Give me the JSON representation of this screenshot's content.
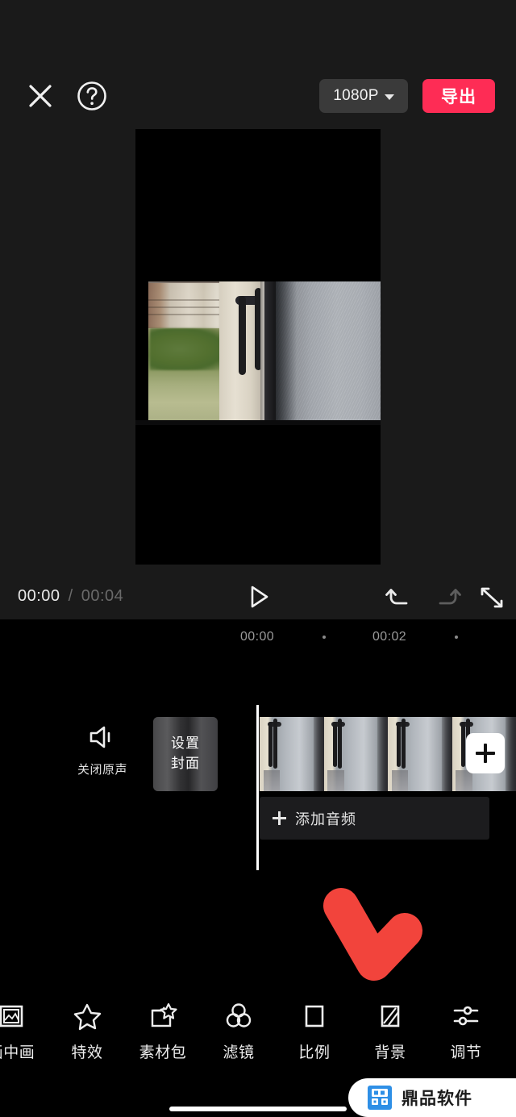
{
  "header": {
    "close_icon": "close-icon",
    "help_icon": "help-circle-icon",
    "resolution": "1080P",
    "resolution_caret": "chevron-down-icon",
    "export_label": "导出"
  },
  "preview": {
    "scene_description": "门口与灰色墙面"
  },
  "player": {
    "current_time": "00:00",
    "separator": "/",
    "total_time": "00:04",
    "play_icon": "play-icon",
    "undo_icon": "undo-icon",
    "redo_icon": "redo-icon",
    "fullscreen_icon": "fullscreen-icon"
  },
  "timeline": {
    "ruler_labels": [
      "00:00",
      "00:02"
    ],
    "mute": {
      "icon": "speaker-mute-icon",
      "label": "关闭原声"
    },
    "cover": {
      "line1": "设置",
      "line2": "封面"
    },
    "add_clip_label": "+",
    "audio_track": {
      "icon": "plus-icon",
      "label": "添加音频"
    }
  },
  "toolbar": {
    "items": [
      {
        "label": "画中画",
        "icon": "picture-in-picture-icon"
      },
      {
        "label": "特效",
        "icon": "star-sparkle-icon"
      },
      {
        "label": "素材包",
        "icon": "material-pack-icon"
      },
      {
        "label": "滤镜",
        "icon": "filter-circles-icon"
      },
      {
        "label": "比例",
        "icon": "aspect-ratio-square-icon"
      },
      {
        "label": "背景",
        "icon": "background-stripes-icon"
      },
      {
        "label": "调节",
        "icon": "adjust-sliders-icon"
      }
    ]
  },
  "annotation": {
    "arrow_color": "#F2443C",
    "arrow_icon": "down-right-arrow-annotation"
  },
  "watermark": {
    "text": "鼎品软件",
    "logo_color": "#2E8FE6"
  }
}
